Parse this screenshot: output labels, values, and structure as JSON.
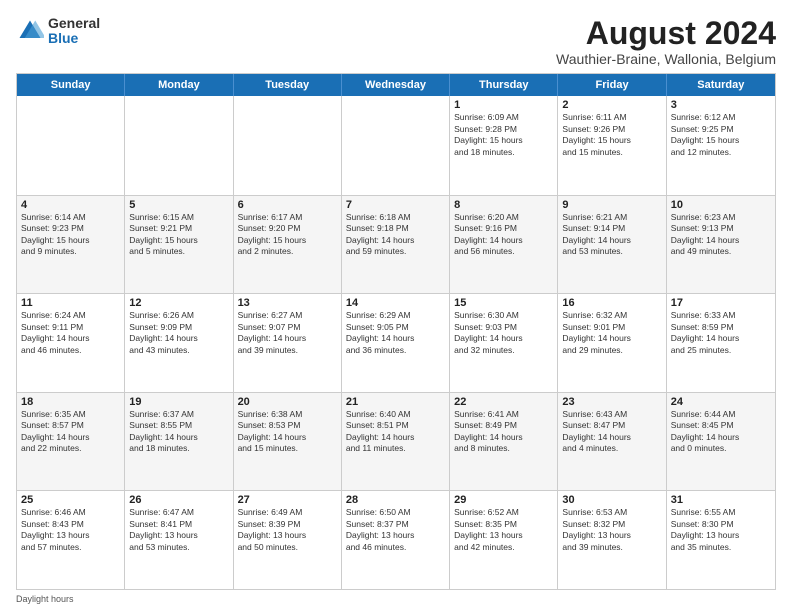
{
  "logo": {
    "general": "General",
    "blue": "Blue"
  },
  "title": "August 2024",
  "subtitle": "Wauthier-Braine, Wallonia, Belgium",
  "days_header": [
    "Sunday",
    "Monday",
    "Tuesday",
    "Wednesday",
    "Thursday",
    "Friday",
    "Saturday"
  ],
  "daylight_label": "Daylight hours",
  "weeks": [
    [
      {
        "day": "",
        "info": ""
      },
      {
        "day": "",
        "info": ""
      },
      {
        "day": "",
        "info": ""
      },
      {
        "day": "",
        "info": ""
      },
      {
        "day": "1",
        "info": "Sunrise: 6:09 AM\nSunset: 9:28 PM\nDaylight: 15 hours\nand 18 minutes."
      },
      {
        "day": "2",
        "info": "Sunrise: 6:11 AM\nSunset: 9:26 PM\nDaylight: 15 hours\nand 15 minutes."
      },
      {
        "day": "3",
        "info": "Sunrise: 6:12 AM\nSunset: 9:25 PM\nDaylight: 15 hours\nand 12 minutes."
      }
    ],
    [
      {
        "day": "4",
        "info": "Sunrise: 6:14 AM\nSunset: 9:23 PM\nDaylight: 15 hours\nand 9 minutes."
      },
      {
        "day": "5",
        "info": "Sunrise: 6:15 AM\nSunset: 9:21 PM\nDaylight: 15 hours\nand 5 minutes."
      },
      {
        "day": "6",
        "info": "Sunrise: 6:17 AM\nSunset: 9:20 PM\nDaylight: 15 hours\nand 2 minutes."
      },
      {
        "day": "7",
        "info": "Sunrise: 6:18 AM\nSunset: 9:18 PM\nDaylight: 14 hours\nand 59 minutes."
      },
      {
        "day": "8",
        "info": "Sunrise: 6:20 AM\nSunset: 9:16 PM\nDaylight: 14 hours\nand 56 minutes."
      },
      {
        "day": "9",
        "info": "Sunrise: 6:21 AM\nSunset: 9:14 PM\nDaylight: 14 hours\nand 53 minutes."
      },
      {
        "day": "10",
        "info": "Sunrise: 6:23 AM\nSunset: 9:13 PM\nDaylight: 14 hours\nand 49 minutes."
      }
    ],
    [
      {
        "day": "11",
        "info": "Sunrise: 6:24 AM\nSunset: 9:11 PM\nDaylight: 14 hours\nand 46 minutes."
      },
      {
        "day": "12",
        "info": "Sunrise: 6:26 AM\nSunset: 9:09 PM\nDaylight: 14 hours\nand 43 minutes."
      },
      {
        "day": "13",
        "info": "Sunrise: 6:27 AM\nSunset: 9:07 PM\nDaylight: 14 hours\nand 39 minutes."
      },
      {
        "day": "14",
        "info": "Sunrise: 6:29 AM\nSunset: 9:05 PM\nDaylight: 14 hours\nand 36 minutes."
      },
      {
        "day": "15",
        "info": "Sunrise: 6:30 AM\nSunset: 9:03 PM\nDaylight: 14 hours\nand 32 minutes."
      },
      {
        "day": "16",
        "info": "Sunrise: 6:32 AM\nSunset: 9:01 PM\nDaylight: 14 hours\nand 29 minutes."
      },
      {
        "day": "17",
        "info": "Sunrise: 6:33 AM\nSunset: 8:59 PM\nDaylight: 14 hours\nand 25 minutes."
      }
    ],
    [
      {
        "day": "18",
        "info": "Sunrise: 6:35 AM\nSunset: 8:57 PM\nDaylight: 14 hours\nand 22 minutes."
      },
      {
        "day": "19",
        "info": "Sunrise: 6:37 AM\nSunset: 8:55 PM\nDaylight: 14 hours\nand 18 minutes."
      },
      {
        "day": "20",
        "info": "Sunrise: 6:38 AM\nSunset: 8:53 PM\nDaylight: 14 hours\nand 15 minutes."
      },
      {
        "day": "21",
        "info": "Sunrise: 6:40 AM\nSunset: 8:51 PM\nDaylight: 14 hours\nand 11 minutes."
      },
      {
        "day": "22",
        "info": "Sunrise: 6:41 AM\nSunset: 8:49 PM\nDaylight: 14 hours\nand 8 minutes."
      },
      {
        "day": "23",
        "info": "Sunrise: 6:43 AM\nSunset: 8:47 PM\nDaylight: 14 hours\nand 4 minutes."
      },
      {
        "day": "24",
        "info": "Sunrise: 6:44 AM\nSunset: 8:45 PM\nDaylight: 14 hours\nand 0 minutes."
      }
    ],
    [
      {
        "day": "25",
        "info": "Sunrise: 6:46 AM\nSunset: 8:43 PM\nDaylight: 13 hours\nand 57 minutes."
      },
      {
        "day": "26",
        "info": "Sunrise: 6:47 AM\nSunset: 8:41 PM\nDaylight: 13 hours\nand 53 minutes."
      },
      {
        "day": "27",
        "info": "Sunrise: 6:49 AM\nSunset: 8:39 PM\nDaylight: 13 hours\nand 50 minutes."
      },
      {
        "day": "28",
        "info": "Sunrise: 6:50 AM\nSunset: 8:37 PM\nDaylight: 13 hours\nand 46 minutes."
      },
      {
        "day": "29",
        "info": "Sunrise: 6:52 AM\nSunset: 8:35 PM\nDaylight: 13 hours\nand 42 minutes."
      },
      {
        "day": "30",
        "info": "Sunrise: 6:53 AM\nSunset: 8:32 PM\nDaylight: 13 hours\nand 39 minutes."
      },
      {
        "day": "31",
        "info": "Sunrise: 6:55 AM\nSunset: 8:30 PM\nDaylight: 13 hours\nand 35 minutes."
      }
    ]
  ]
}
